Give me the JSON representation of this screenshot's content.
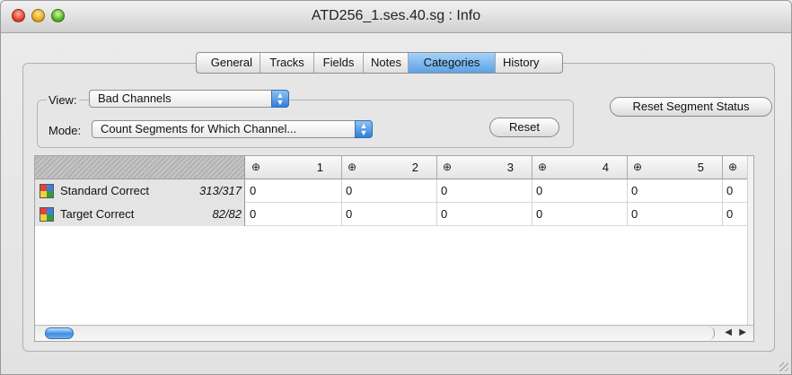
{
  "window": {
    "title": "ATD256_1.ses.40.sg : Info",
    "controls": [
      "close",
      "minimize",
      "zoom"
    ]
  },
  "tabs": [
    {
      "label": "General",
      "selected": false
    },
    {
      "label": "Tracks",
      "selected": false
    },
    {
      "label": "Fields",
      "selected": false
    },
    {
      "label": "Notes",
      "selected": false
    },
    {
      "label": "Categories",
      "selected": true
    },
    {
      "label": "History",
      "selected": false
    }
  ],
  "controls": {
    "view_label": "View:",
    "view_value": "Bad Channels",
    "mode_label": "Mode:",
    "mode_value": "Count Segments for Which Channel...",
    "reset_label": "Reset",
    "reset_segment_status_label": "Reset Segment Status"
  },
  "table": {
    "columns": [
      "1",
      "2",
      "3",
      "4",
      "5",
      ""
    ],
    "column_icon": "target-icon",
    "rows": [
      {
        "name": "Standard Correct",
        "count": "313/317",
        "values": [
          "0",
          "0",
          "0",
          "0",
          "0",
          "0"
        ]
      },
      {
        "name": "Target Correct",
        "count": "82/82",
        "values": [
          "0",
          "0",
          "0",
          "0",
          "0",
          "0"
        ]
      }
    ],
    "row_icon_colors": [
      "#e8403a",
      "#3a7fe0",
      "#f0d23a",
      "#2e9e44"
    ]
  },
  "accent_color": "#5aa3e6"
}
